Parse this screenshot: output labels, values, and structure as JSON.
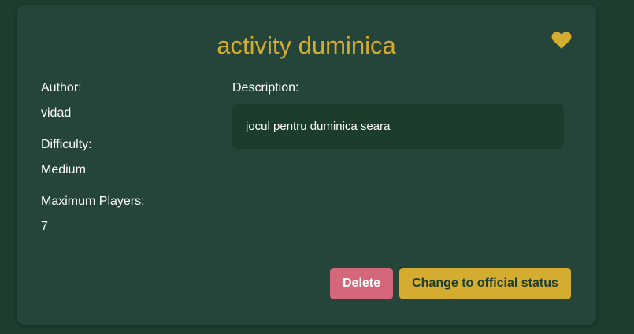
{
  "card": {
    "title": "activity duminica",
    "favorite_icon": "heart-icon",
    "author_label": "Author:",
    "author_value": "vidad",
    "difficulty_label": "Difficulty:",
    "difficulty_value": "Medium",
    "max_players_label": "Maximum Players:",
    "max_players_value": "7",
    "description_label": "Description:",
    "description_value": "jocul pentru duminica seara",
    "delete_label": "Delete",
    "official_label": "Change to official status"
  },
  "colors": {
    "background": "#1d3d2e",
    "card": "#26453a",
    "accent": "#d4ac30",
    "delete": "#d4677a",
    "description_box": "#1c3d2c"
  }
}
